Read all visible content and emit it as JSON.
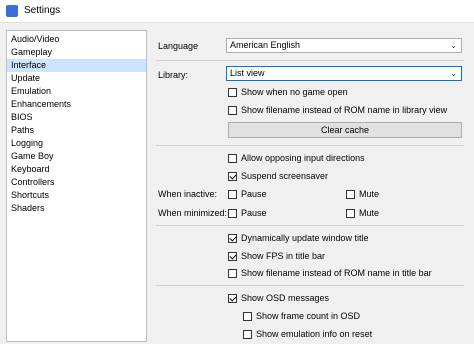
{
  "window": {
    "title": "Settings"
  },
  "sidebar": {
    "items": [
      {
        "label": "Audio/Video"
      },
      {
        "label": "Gameplay"
      },
      {
        "label": "Interface"
      },
      {
        "label": "Update"
      },
      {
        "label": "Emulation"
      },
      {
        "label": "Enhancements"
      },
      {
        "label": "BIOS"
      },
      {
        "label": "Paths"
      },
      {
        "label": "Logging"
      },
      {
        "label": "Game Boy"
      },
      {
        "label": "Keyboard"
      },
      {
        "label": "Controllers"
      },
      {
        "label": "Shortcuts"
      },
      {
        "label": "Shaders"
      }
    ],
    "selected": "Interface"
  },
  "interface": {
    "language_label": "Language",
    "language_value": "American English",
    "library_label": "Library:",
    "library_value": "List view",
    "show_when_no_game": "Show when no game open",
    "show_filename_library": "Show filename instead of ROM name in library view",
    "clear_cache": "Clear cache",
    "allow_opposing": "Allow opposing input directions",
    "suspend_screensaver": "Suspend screensaver",
    "when_inactive_label": "When inactive:",
    "when_minimized_label": "When minimized:",
    "pause": "Pause",
    "mute": "Mute",
    "dynamic_title": "Dynamically update window title",
    "show_fps": "Show FPS in title bar",
    "show_filename_title": "Show filename instead of ROM name in title bar",
    "show_osd": "Show OSD messages",
    "show_frame_count": "Show frame count in OSD",
    "show_emulation_info": "Show emulation info on reset"
  },
  "checked": {
    "show_when_no_game": false,
    "show_filename_library": false,
    "allow_opposing": false,
    "suspend_screensaver": true,
    "inactive_pause": false,
    "inactive_mute": false,
    "minimized_pause": false,
    "minimized_mute": false,
    "dynamic_title": true,
    "show_fps": true,
    "show_filename_title": false,
    "show_osd": true,
    "show_frame_count": false,
    "show_emulation_info": false
  }
}
